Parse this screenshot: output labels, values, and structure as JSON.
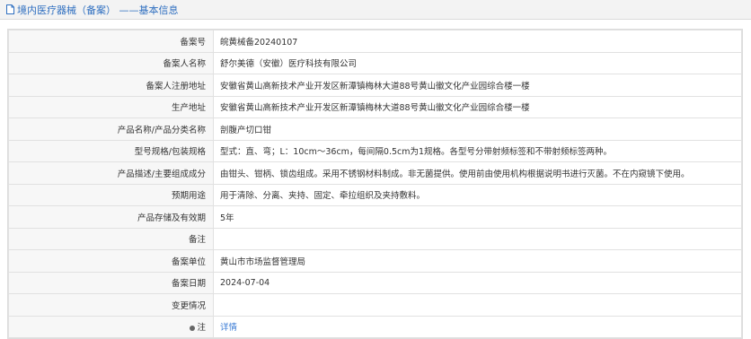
{
  "header": {
    "title": "境内医疗器械（备案） ——基本信息"
  },
  "rows": [
    {
      "label": "备案号",
      "value": "皖黄械备20240107"
    },
    {
      "label": "备案人名称",
      "value": "舒尔美德（安徽）医疗科技有限公司"
    },
    {
      "label": "备案人注册地址",
      "value": "安徽省黄山高新技术产业开发区新潭镇梅林大道88号黄山徽文化产业园综合楼一楼"
    },
    {
      "label": "生产地址",
      "value": "安徽省黄山高新技术产业开发区新潭镇梅林大道88号黄山徽文化产业园综合楼一楼"
    },
    {
      "label": "产品名称/产品分类名称",
      "value": "剖腹产切口钳"
    },
    {
      "label": "型号规格/包装规格",
      "value": "型式：直、弯；L：10cm～36cm，每间隔0.5cm为1规格。各型号分带射频标签和不带射频标签两种。"
    },
    {
      "label": "产品描述/主要组成成分",
      "value": "由钳头、钳柄、锁齿组成。采用不锈钢材料制成。非无菌提供。使用前由使用机构根据说明书进行灭菌。不在内窥镜下使用。"
    },
    {
      "label": "预期用途",
      "value": "用于清除、分离、夹持、固定、牵拉组织及夹持敷料。"
    },
    {
      "label": "产品存储及有效期",
      "value": "5年"
    },
    {
      "label": "备注",
      "value": ""
    },
    {
      "label": "备案单位",
      "value": "黄山市市场监督管理局"
    },
    {
      "label": "备案日期",
      "value": "2024-07-04"
    },
    {
      "label": "变更情况",
      "value": ""
    }
  ],
  "note_row": {
    "label": "注",
    "icon": "note-pin-icon",
    "link_text": "详情"
  }
}
